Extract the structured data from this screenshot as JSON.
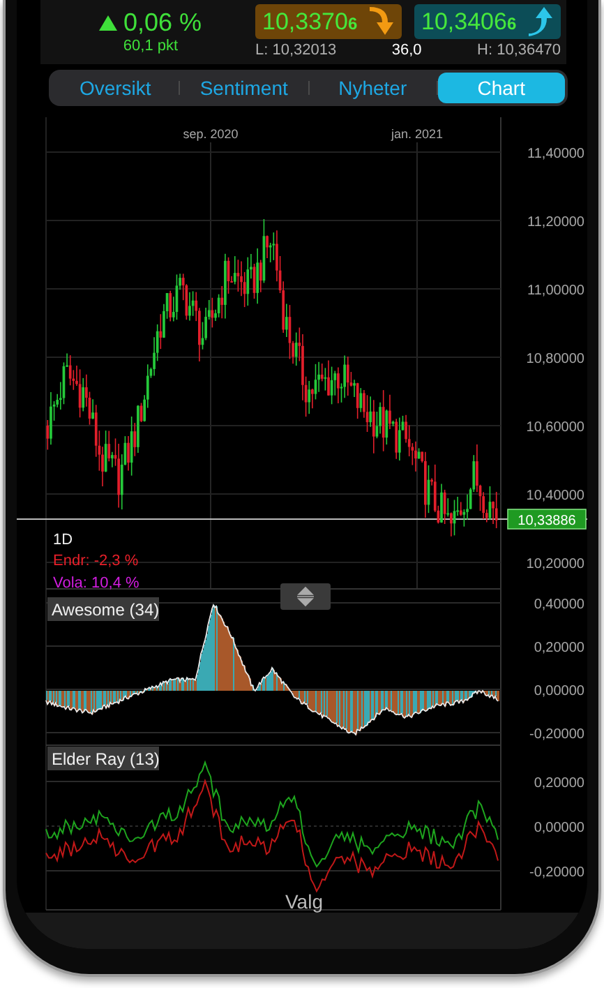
{
  "quote": {
    "rising": true,
    "change": "0,06 %",
    "points": "60,1 pkt"
  },
  "prices": [
    {
      "kind": "bid",
      "price": "10,3370",
      "pip": "6",
      "rising": false
    },
    {
      "kind": "ask",
      "price": "10,3406",
      "pip": "6",
      "rising": true
    }
  ],
  "range": {
    "low": "L: 10,32013",
    "spread": "36,0",
    "high": "H: 10,36470"
  },
  "tabs": [
    {
      "label": "Oversikt",
      "selected": false
    },
    {
      "label": "Sentiment",
      "selected": false
    },
    {
      "label": "Nyheter",
      "selected": false
    },
    {
      "label": "Chart",
      "selected": true
    }
  ],
  "chart": {
    "x_labels": [
      "sep. 2020",
      "jan. 2021"
    ],
    "y_labels": [
      "11,40000",
      "11,20000",
      "11,00000",
      "10,80000",
      "10,60000",
      "10,40000",
      "10,20000"
    ],
    "last_price": "10,33886",
    "interval": "1D",
    "change": "Endr: -2,3 %",
    "volatility": "Vola: 10,4 %"
  },
  "indicators": [
    {
      "name": "Awesome (34)",
      "kind": "histogram",
      "y_labels": [
        "0,40000",
        "0,20000",
        "0,00000",
        "-0,20000"
      ]
    },
    {
      "name": "Elder Ray (13)",
      "kind": "lines",
      "y_labels": [
        "0,20000",
        "0,00000",
        "-0,20000"
      ]
    }
  ],
  "footer_button": "Valg"
}
